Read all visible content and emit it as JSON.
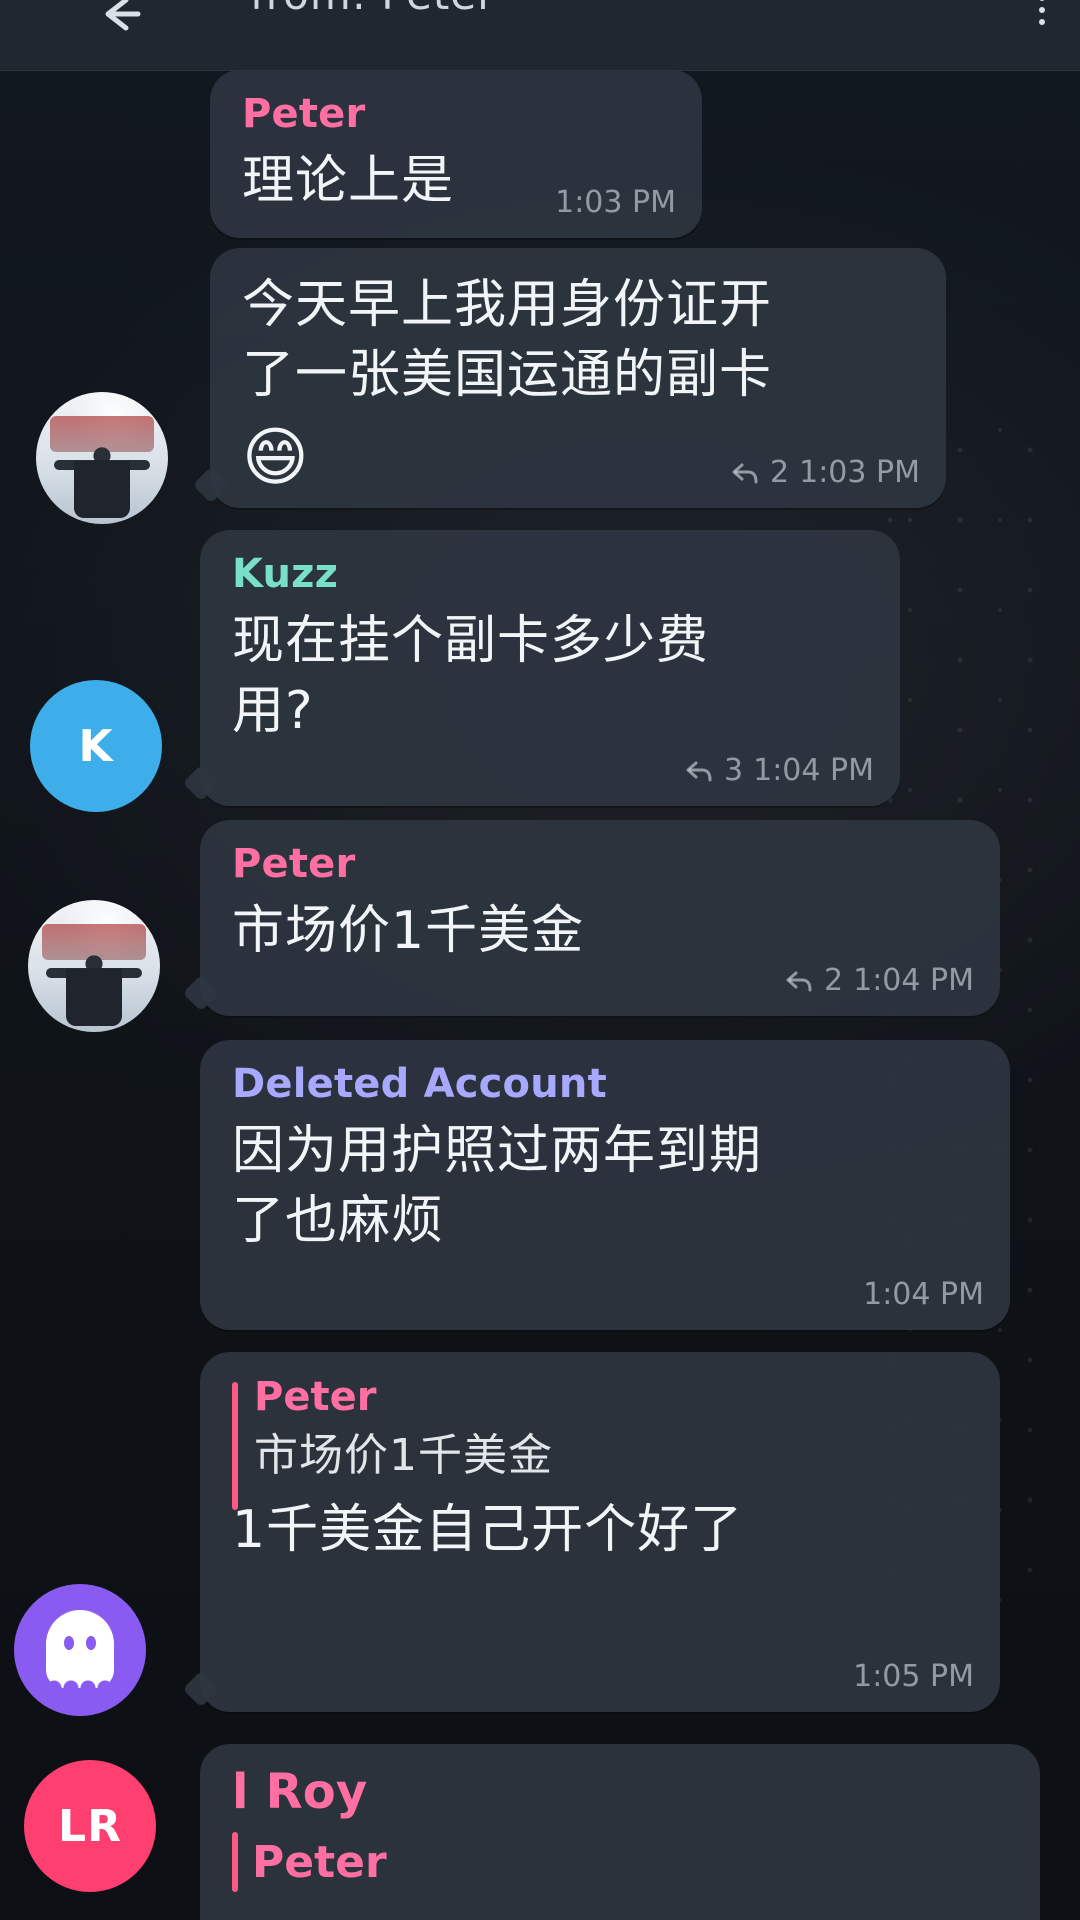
{
  "header": {
    "title": "from: Peter"
  },
  "colors": {
    "peter": "#ff6fa2",
    "kuzz": "#79e0c8",
    "deleted": "#a9a8ff",
    "roy": "#ff6fa2",
    "kAvatar": "#3daeea",
    "lrAvatar": "#ff3f6f",
    "ghostAvatar": "#8a5bf0"
  },
  "messages": [
    {
      "sender": "Peter",
      "text": "理论上是",
      "time": "1:03 PM"
    },
    {
      "text_lines": [
        "今天早上我用身份证开",
        "了一张美国运通的副卡"
      ],
      "emoji": "😄",
      "reply_count": "2",
      "time": "1:03 PM"
    },
    {
      "sender": "Kuzz",
      "text_lines": [
        "现在挂个副卡多少费",
        "用?"
      ],
      "reply_count": "3",
      "time": "1:04 PM"
    },
    {
      "sender": "Peter",
      "text": "市场价1千美金",
      "reply_count": "2",
      "time": "1:04 PM"
    },
    {
      "sender": "Deleted Account",
      "text_lines": [
        "因为用护照过两年到期",
        "了也麻烦"
      ],
      "time": "1:04 PM"
    },
    {
      "quote_sender": "Peter",
      "quote_text": "市场价1千美金",
      "text": "1千美金自己开个好了",
      "time": "1:05 PM"
    },
    {
      "sender": "l Roy",
      "reply_preview_sender": "Peter"
    }
  ],
  "avatars": {
    "k_initial": "K",
    "lr_initials": "LR"
  }
}
